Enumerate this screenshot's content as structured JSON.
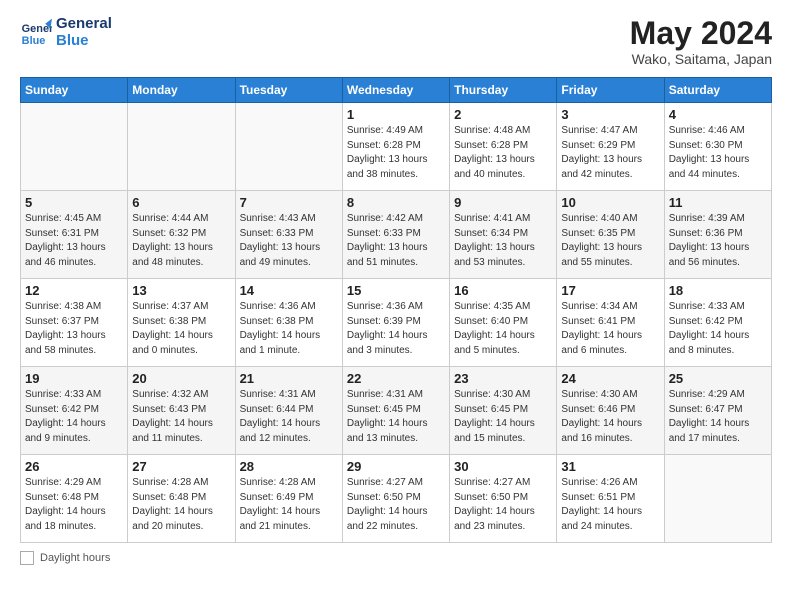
{
  "header": {
    "logo_line1": "General",
    "logo_line2": "Blue",
    "month_title": "May 2024",
    "location": "Wako, Saitama, Japan"
  },
  "days_of_week": [
    "Sunday",
    "Monday",
    "Tuesday",
    "Wednesday",
    "Thursday",
    "Friday",
    "Saturday"
  ],
  "weeks": [
    [
      {
        "num": "",
        "info": ""
      },
      {
        "num": "",
        "info": ""
      },
      {
        "num": "",
        "info": ""
      },
      {
        "num": "1",
        "info": "Sunrise: 4:49 AM\nSunset: 6:28 PM\nDaylight: 13 hours\nand 38 minutes."
      },
      {
        "num": "2",
        "info": "Sunrise: 4:48 AM\nSunset: 6:28 PM\nDaylight: 13 hours\nand 40 minutes."
      },
      {
        "num": "3",
        "info": "Sunrise: 4:47 AM\nSunset: 6:29 PM\nDaylight: 13 hours\nand 42 minutes."
      },
      {
        "num": "4",
        "info": "Sunrise: 4:46 AM\nSunset: 6:30 PM\nDaylight: 13 hours\nand 44 minutes."
      }
    ],
    [
      {
        "num": "5",
        "info": "Sunrise: 4:45 AM\nSunset: 6:31 PM\nDaylight: 13 hours\nand 46 minutes."
      },
      {
        "num": "6",
        "info": "Sunrise: 4:44 AM\nSunset: 6:32 PM\nDaylight: 13 hours\nand 48 minutes."
      },
      {
        "num": "7",
        "info": "Sunrise: 4:43 AM\nSunset: 6:33 PM\nDaylight: 13 hours\nand 49 minutes."
      },
      {
        "num": "8",
        "info": "Sunrise: 4:42 AM\nSunset: 6:33 PM\nDaylight: 13 hours\nand 51 minutes."
      },
      {
        "num": "9",
        "info": "Sunrise: 4:41 AM\nSunset: 6:34 PM\nDaylight: 13 hours\nand 53 minutes."
      },
      {
        "num": "10",
        "info": "Sunrise: 4:40 AM\nSunset: 6:35 PM\nDaylight: 13 hours\nand 55 minutes."
      },
      {
        "num": "11",
        "info": "Sunrise: 4:39 AM\nSunset: 6:36 PM\nDaylight: 13 hours\nand 56 minutes."
      }
    ],
    [
      {
        "num": "12",
        "info": "Sunrise: 4:38 AM\nSunset: 6:37 PM\nDaylight: 13 hours\nand 58 minutes."
      },
      {
        "num": "13",
        "info": "Sunrise: 4:37 AM\nSunset: 6:38 PM\nDaylight: 14 hours\nand 0 minutes."
      },
      {
        "num": "14",
        "info": "Sunrise: 4:36 AM\nSunset: 6:38 PM\nDaylight: 14 hours\nand 1 minute."
      },
      {
        "num": "15",
        "info": "Sunrise: 4:36 AM\nSunset: 6:39 PM\nDaylight: 14 hours\nand 3 minutes."
      },
      {
        "num": "16",
        "info": "Sunrise: 4:35 AM\nSunset: 6:40 PM\nDaylight: 14 hours\nand 5 minutes."
      },
      {
        "num": "17",
        "info": "Sunrise: 4:34 AM\nSunset: 6:41 PM\nDaylight: 14 hours\nand 6 minutes."
      },
      {
        "num": "18",
        "info": "Sunrise: 4:33 AM\nSunset: 6:42 PM\nDaylight: 14 hours\nand 8 minutes."
      }
    ],
    [
      {
        "num": "19",
        "info": "Sunrise: 4:33 AM\nSunset: 6:42 PM\nDaylight: 14 hours\nand 9 minutes."
      },
      {
        "num": "20",
        "info": "Sunrise: 4:32 AM\nSunset: 6:43 PM\nDaylight: 14 hours\nand 11 minutes."
      },
      {
        "num": "21",
        "info": "Sunrise: 4:31 AM\nSunset: 6:44 PM\nDaylight: 14 hours\nand 12 minutes."
      },
      {
        "num": "22",
        "info": "Sunrise: 4:31 AM\nSunset: 6:45 PM\nDaylight: 14 hours\nand 13 minutes."
      },
      {
        "num": "23",
        "info": "Sunrise: 4:30 AM\nSunset: 6:45 PM\nDaylight: 14 hours\nand 15 minutes."
      },
      {
        "num": "24",
        "info": "Sunrise: 4:30 AM\nSunset: 6:46 PM\nDaylight: 14 hours\nand 16 minutes."
      },
      {
        "num": "25",
        "info": "Sunrise: 4:29 AM\nSunset: 6:47 PM\nDaylight: 14 hours\nand 17 minutes."
      }
    ],
    [
      {
        "num": "26",
        "info": "Sunrise: 4:29 AM\nSunset: 6:48 PM\nDaylight: 14 hours\nand 18 minutes."
      },
      {
        "num": "27",
        "info": "Sunrise: 4:28 AM\nSunset: 6:48 PM\nDaylight: 14 hours\nand 20 minutes."
      },
      {
        "num": "28",
        "info": "Sunrise: 4:28 AM\nSunset: 6:49 PM\nDaylight: 14 hours\nand 21 minutes."
      },
      {
        "num": "29",
        "info": "Sunrise: 4:27 AM\nSunset: 6:50 PM\nDaylight: 14 hours\nand 22 minutes."
      },
      {
        "num": "30",
        "info": "Sunrise: 4:27 AM\nSunset: 6:50 PM\nDaylight: 14 hours\nand 23 minutes."
      },
      {
        "num": "31",
        "info": "Sunrise: 4:26 AM\nSunset: 6:51 PM\nDaylight: 14 hours\nand 24 minutes."
      },
      {
        "num": "",
        "info": ""
      }
    ]
  ],
  "footer": {
    "label": "Daylight hours"
  }
}
